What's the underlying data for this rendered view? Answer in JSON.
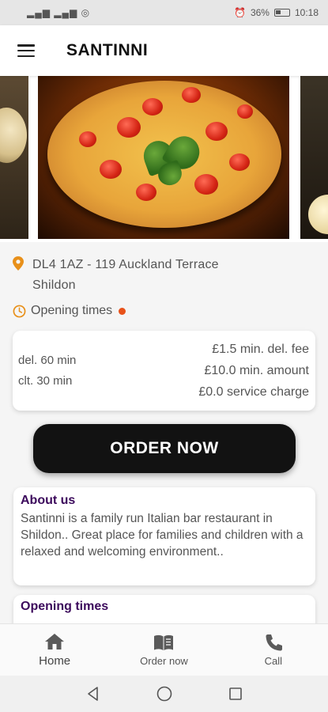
{
  "status_bar": {
    "signal_text": "▂▄▆ ▂▄▆ ◎",
    "battery_percent": "36%",
    "time": "10:18"
  },
  "app_bar": {
    "title": "SANTINNI"
  },
  "location": {
    "address_line1": "DL4 1AZ - 119 Auckland Terrace",
    "address_line2": "Shildon"
  },
  "opening": {
    "label": "Opening times",
    "status_color": "#e8521a"
  },
  "delivery": {
    "delivery_time": "del. 60 min",
    "collection_time": "clt. 30 min",
    "delivery_fee": "£1.5 min. del. fee",
    "min_amount": "£10.0 min. amount",
    "service_charge": "£0.0 service charge"
  },
  "order_button": {
    "label": "ORDER NOW"
  },
  "about": {
    "title": "About us",
    "text": "Santinni is a family run Italian bar restaurant in Shildon.. Great place for families and children with a relaxed and welcoming environment.."
  },
  "hours_section": {
    "title": "Opening times"
  },
  "bottom_nav": {
    "home": "Home",
    "order_now": "Order now",
    "call": "Call"
  },
  "colors": {
    "accent_orange": "#e8901a",
    "heading_purple": "#3c0a5c",
    "button_black": "#121212"
  }
}
